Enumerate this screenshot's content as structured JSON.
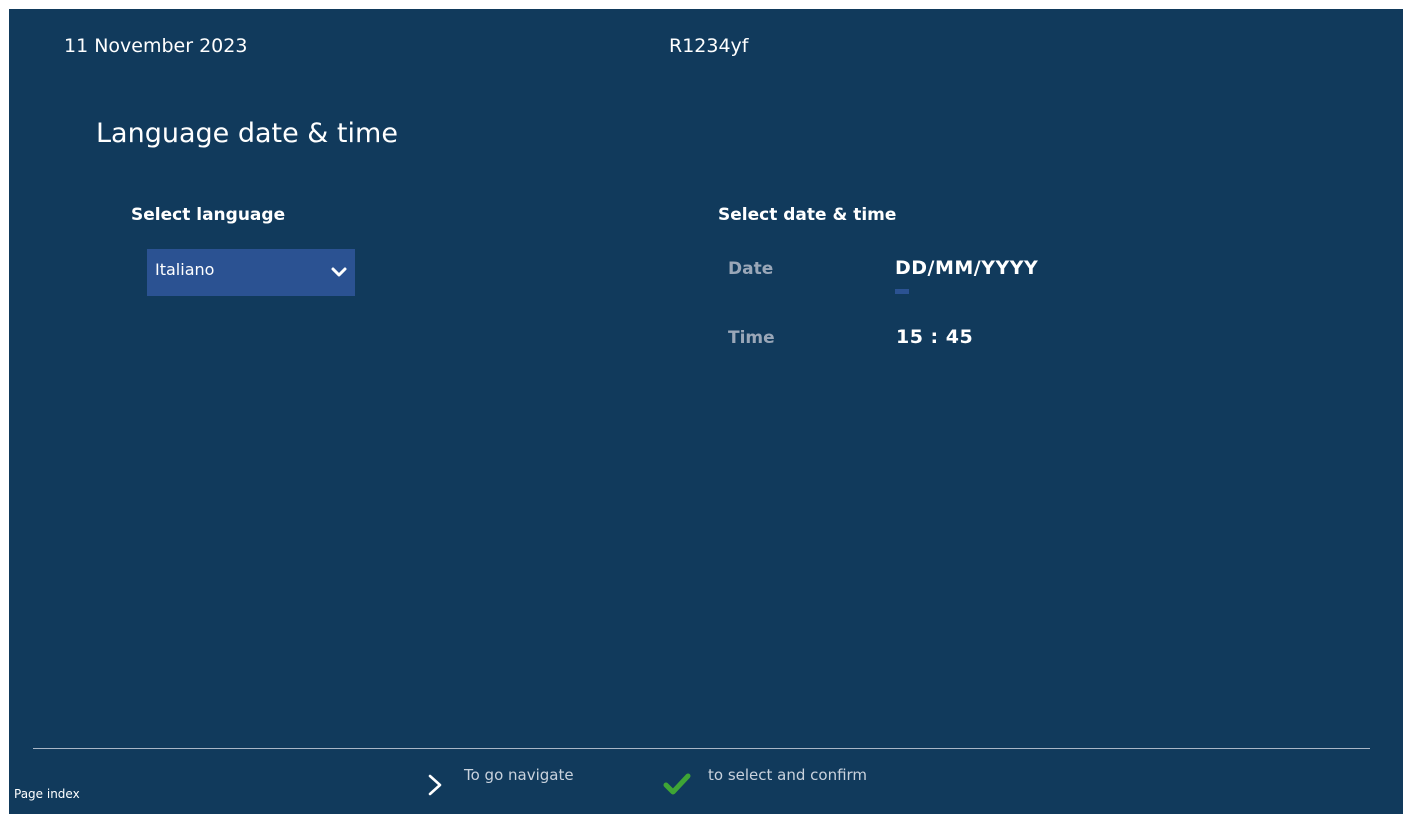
{
  "header": {
    "date": "11 November 2023",
    "refrigerant": "R1234yf"
  },
  "page": {
    "title": "Language date & time"
  },
  "language": {
    "label": "Select language",
    "selected": "Italiano",
    "chevron_icon": "chevron-down-icon"
  },
  "datetime": {
    "label": "Select date & time",
    "date_label": "Date",
    "date_value": "DD/MM/YYYY",
    "time_label": "Time",
    "time_value": "15 : 45"
  },
  "footer": {
    "page_index": "Page index",
    "navigate_icon": "chevron-right-icon",
    "navigate_text": "To go navigate",
    "confirm_icon": "checkmark-icon",
    "confirm_text": "to select and confirm"
  },
  "colors": {
    "background": "#113a5c",
    "select_bg": "#2b5292",
    "check_green": "#3fa535"
  }
}
